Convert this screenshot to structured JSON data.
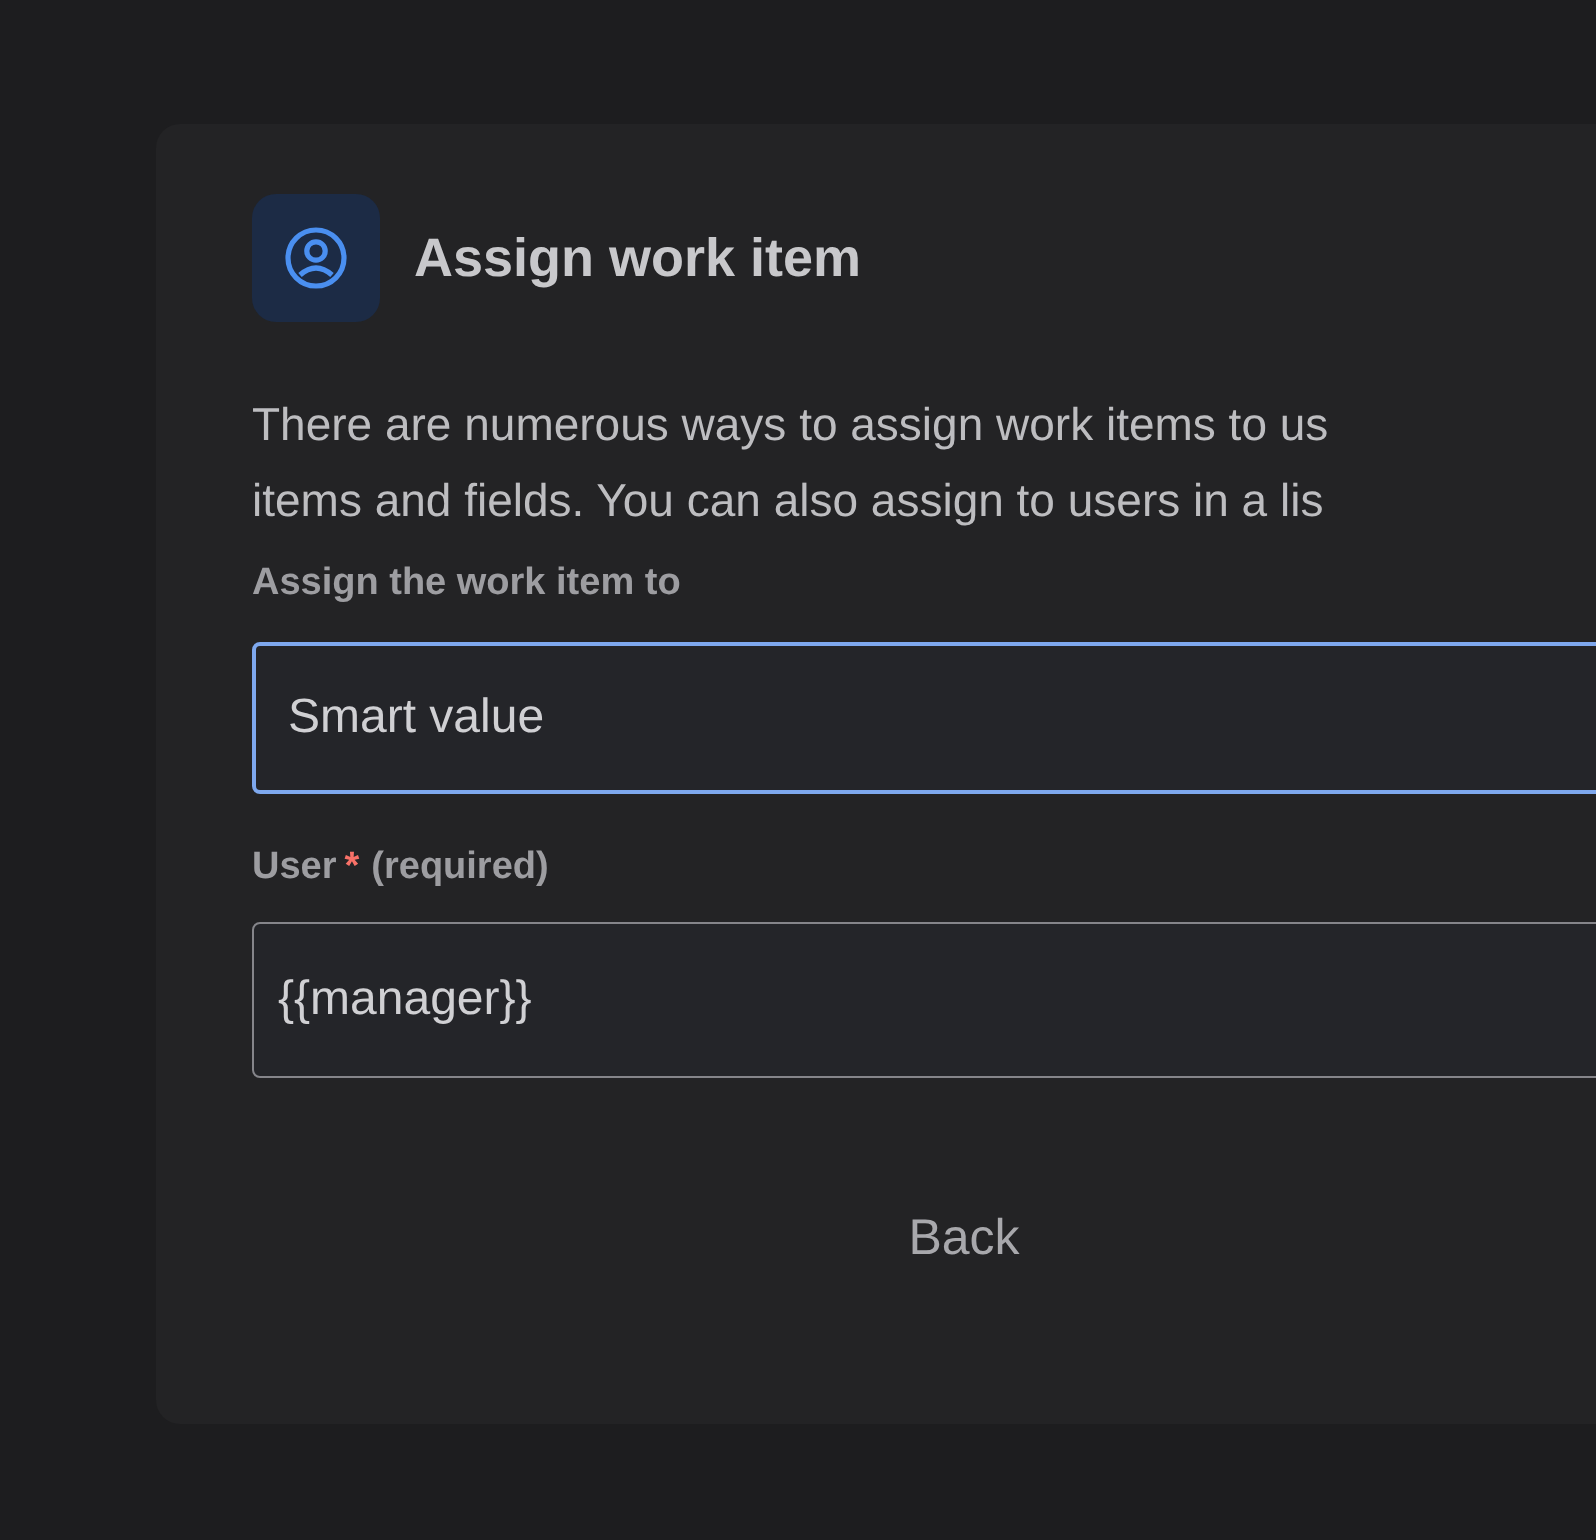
{
  "dialog": {
    "title": "Assign work item",
    "description": [
      "There are numerous ways to assign work items to us",
      "items and fields. You can also assign to users in a lis"
    ],
    "fields": [
      {
        "label": "Assign the work item to",
        "value": "Smart value",
        "focused": true
      },
      {
        "label": "User",
        "required_mark": "*",
        "required_note": "(required)",
        "value": "{{manager}}",
        "focused": false
      }
    ],
    "buttons": [
      "Back"
    ]
  }
}
